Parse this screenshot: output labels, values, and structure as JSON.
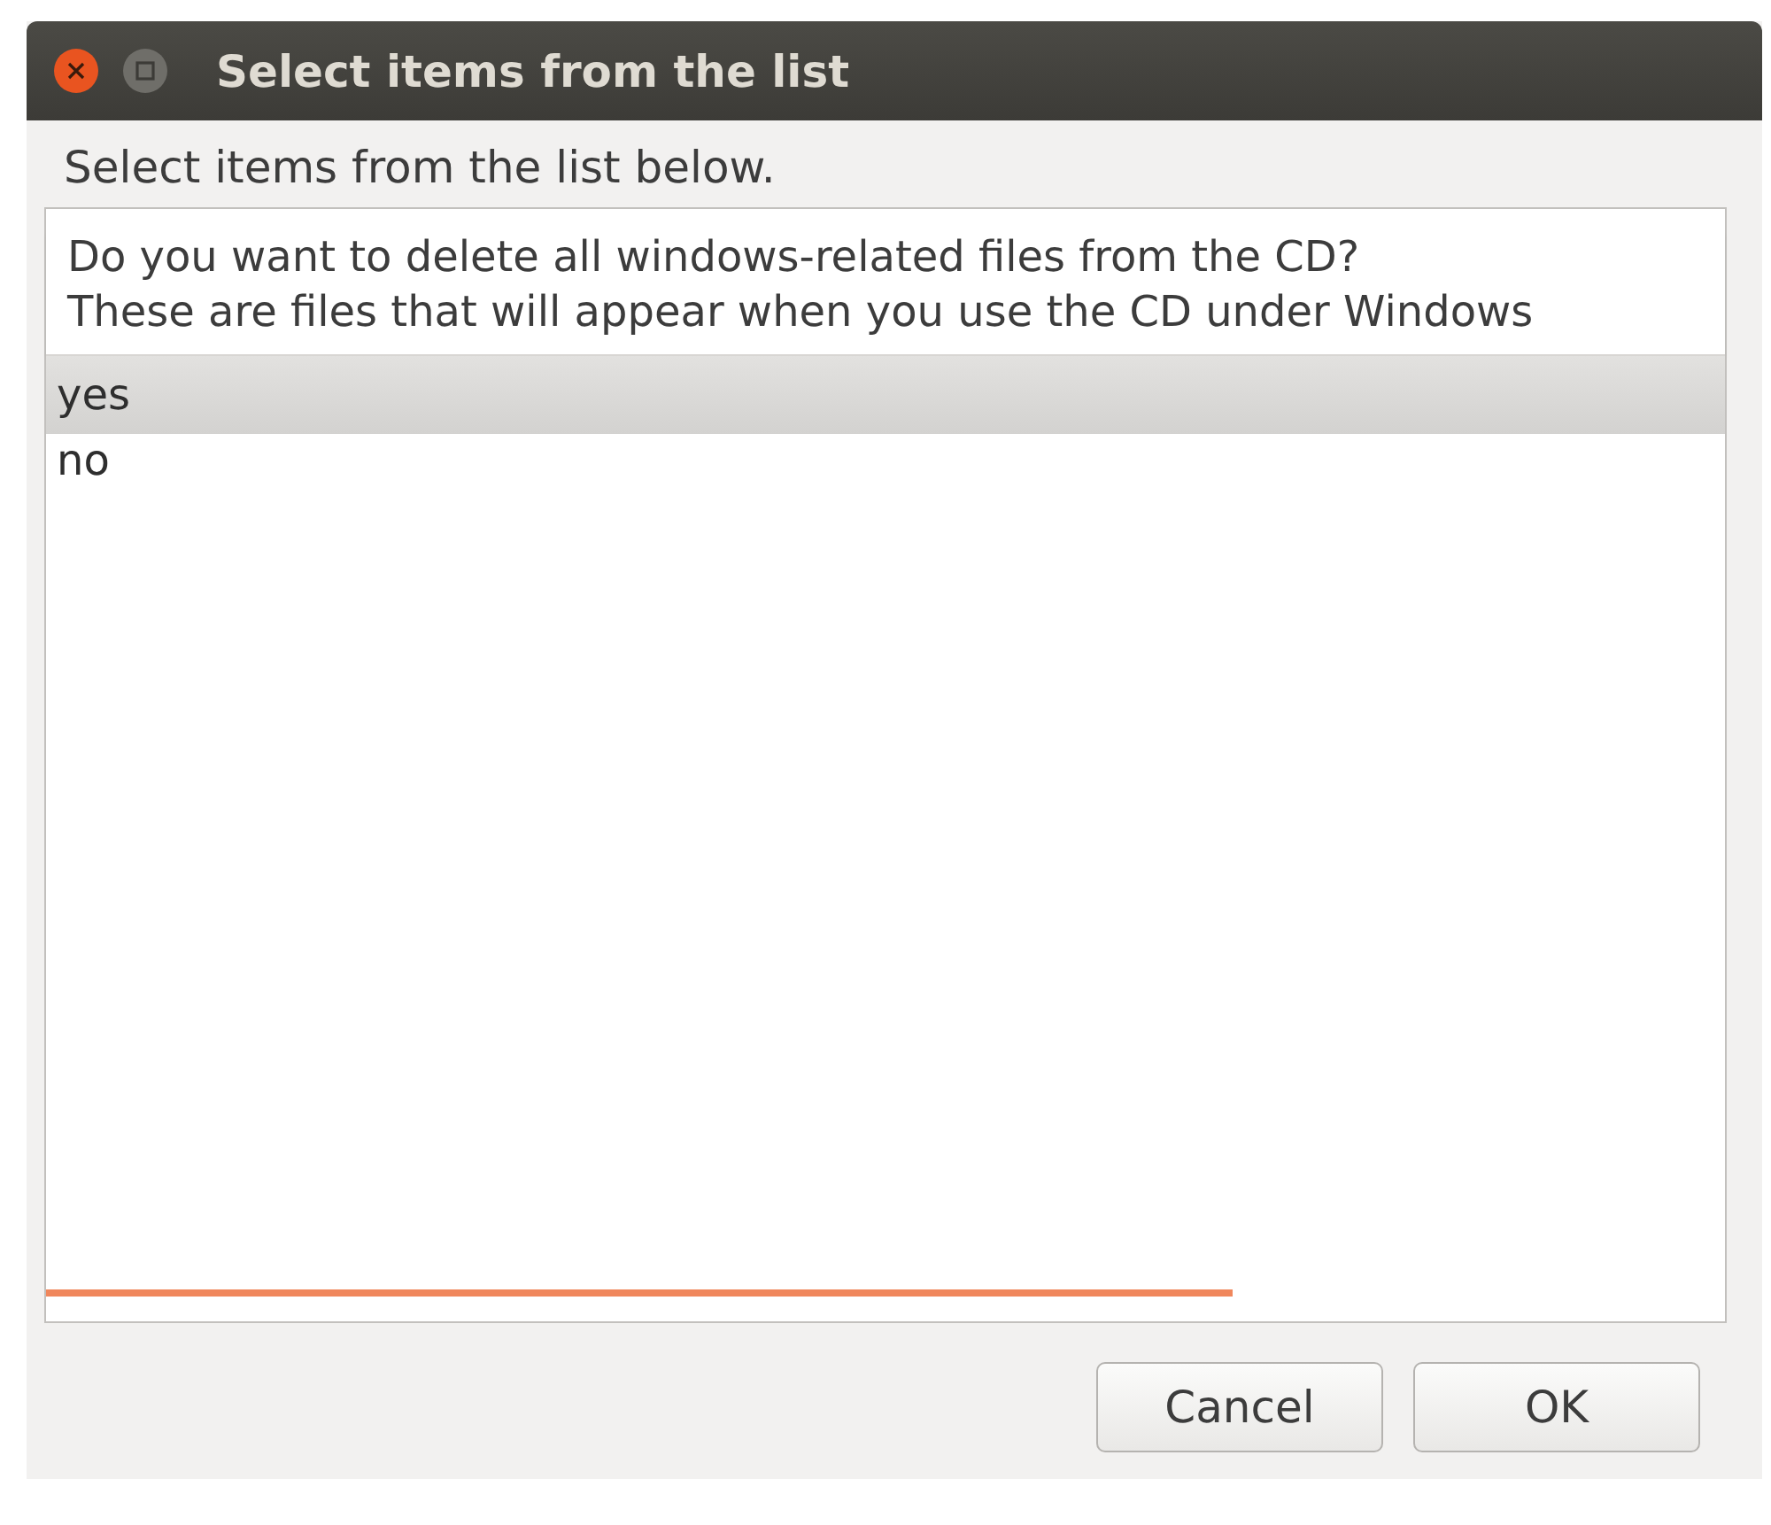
{
  "window": {
    "title": "Select items from the list"
  },
  "prompt": "Select items from the list below.",
  "list": {
    "column_header": "Do you want to delete all windows-related files from the CD?\nThese are files that will appear when you use the CD under Windows",
    "rows": [
      {
        "label": "yes",
        "selected": true
      },
      {
        "label": "no",
        "selected": false
      }
    ]
  },
  "buttons": [
    "Cancel",
    "OK"
  ]
}
